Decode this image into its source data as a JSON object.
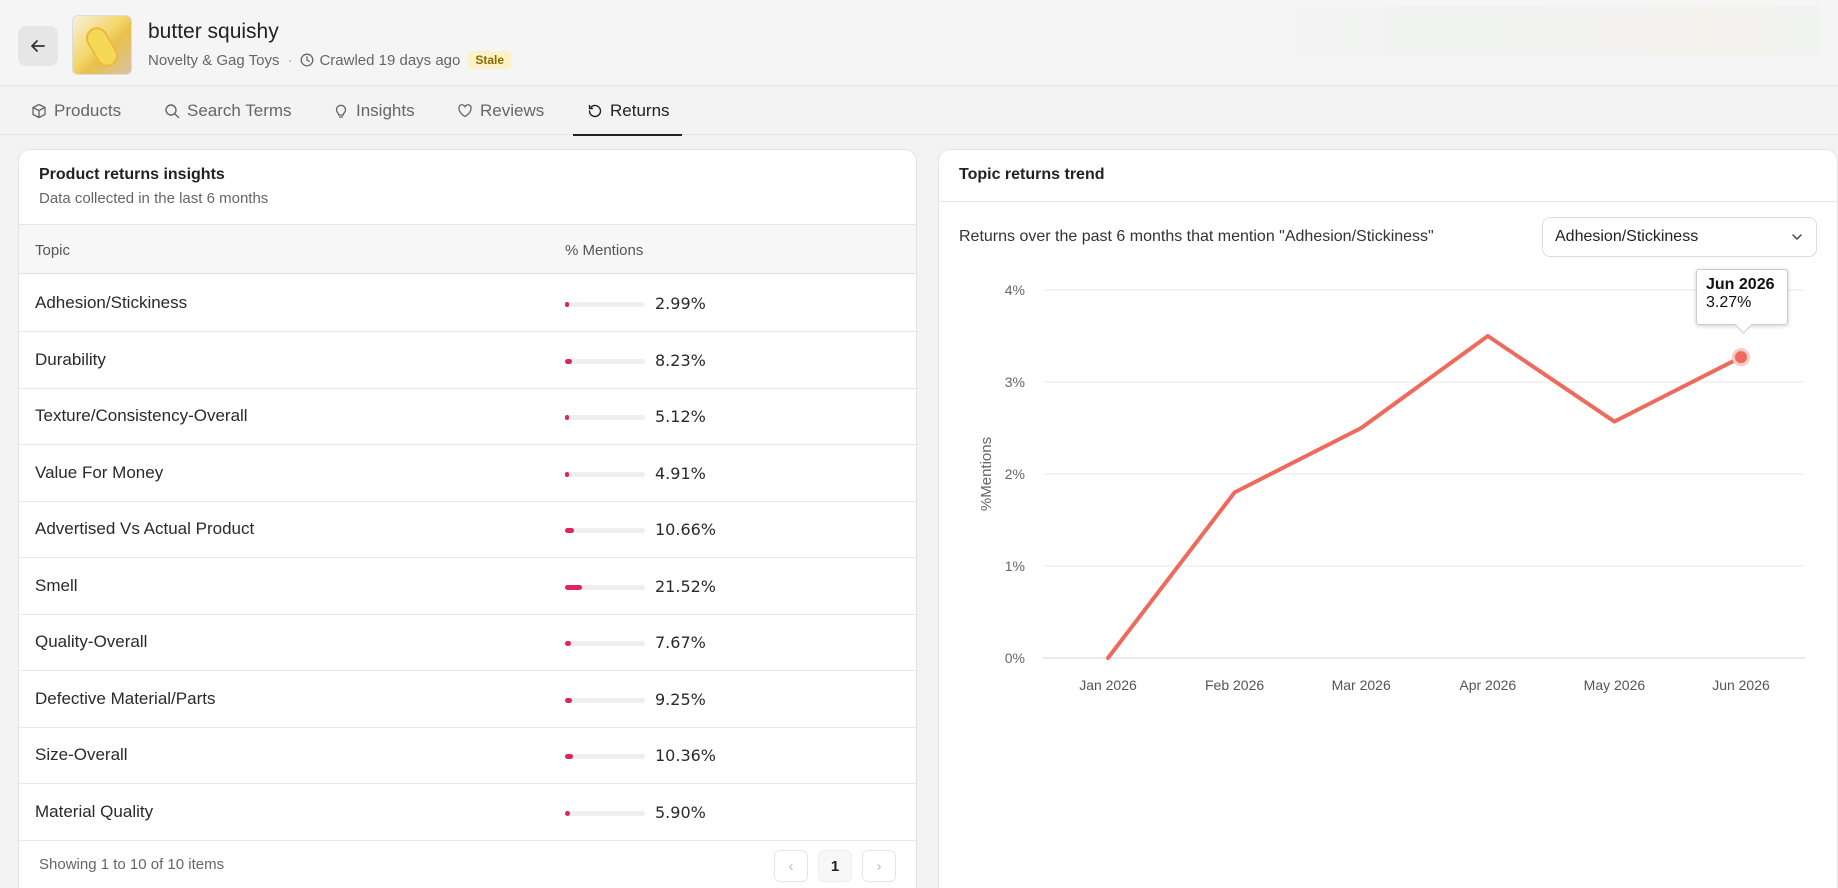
{
  "header": {
    "title": "butter squishy",
    "category": "Novelty & Gag Toys",
    "separator": "·",
    "crawled": "Crawled 19 days ago",
    "status_badge": "Stale"
  },
  "tabs": [
    {
      "label": "Products",
      "icon": "box-icon"
    },
    {
      "label": "Search Terms",
      "icon": "search-icon"
    },
    {
      "label": "Insights",
      "icon": "lightbulb-icon"
    },
    {
      "label": "Reviews",
      "icon": "heart-icon"
    },
    {
      "label": "Returns",
      "icon": "refresh-icon",
      "active": true
    }
  ],
  "insights_card": {
    "title": "Product returns insights",
    "subtitle": "Data collected in the last 6 months",
    "columns": [
      "Topic",
      "% Mentions"
    ],
    "rows": [
      {
        "topic": "Adhesion/Stickiness",
        "pct": "2.99%",
        "value": 2.99
      },
      {
        "topic": "Durability",
        "pct": "8.23%",
        "value": 8.23
      },
      {
        "topic": "Texture/Consistency-Overall",
        "pct": "5.12%",
        "value": 5.12
      },
      {
        "topic": "Value For Money",
        "pct": "4.91%",
        "value": 4.91
      },
      {
        "topic": "Advertised Vs Actual Product",
        "pct": "10.66%",
        "value": 10.66
      },
      {
        "topic": "Smell",
        "pct": "21.52%",
        "value": 21.52
      },
      {
        "topic": "Quality-Overall",
        "pct": "7.67%",
        "value": 7.67
      },
      {
        "topic": "Defective Material/Parts",
        "pct": "9.25%",
        "value": 9.25
      },
      {
        "topic": "Size-Overall",
        "pct": "10.36%",
        "value": 10.36
      },
      {
        "topic": "Material Quality",
        "pct": "5.90%",
        "value": 5.9
      }
    ],
    "footer": "Showing 1 to 10 of 10 items",
    "pagination": {
      "prev": "‹",
      "current": "1",
      "next": "›"
    }
  },
  "trend_card": {
    "title": "Topic returns trend",
    "description": "Returns over the past 6 months that mention \"Adhesion/Stickiness\"",
    "select_value": "Adhesion/Stickiness",
    "tooltip": {
      "date": "Jun 2026",
      "value": "3.27%"
    }
  },
  "colors": {
    "accent": "#e0245e",
    "line": "#ee6a5c",
    "stale_bg": "#fdf1c8"
  },
  "chart_data": {
    "type": "line",
    "x": [
      "Jan 2026",
      "Feb 2026",
      "Mar 2026",
      "Apr 2026",
      "May 2026",
      "Jun 2026"
    ],
    "series": [
      {
        "values": [
          0,
          1.8,
          2.5,
          3.5,
          2.57,
          3.27
        ]
      }
    ],
    "ylabel": "%Mentions",
    "ylim": [
      0,
      4
    ],
    "yticks": [
      "0%",
      "1%",
      "2%",
      "3%",
      "4%"
    ],
    "grid": true,
    "highlighted_point": "Jun 2026"
  }
}
